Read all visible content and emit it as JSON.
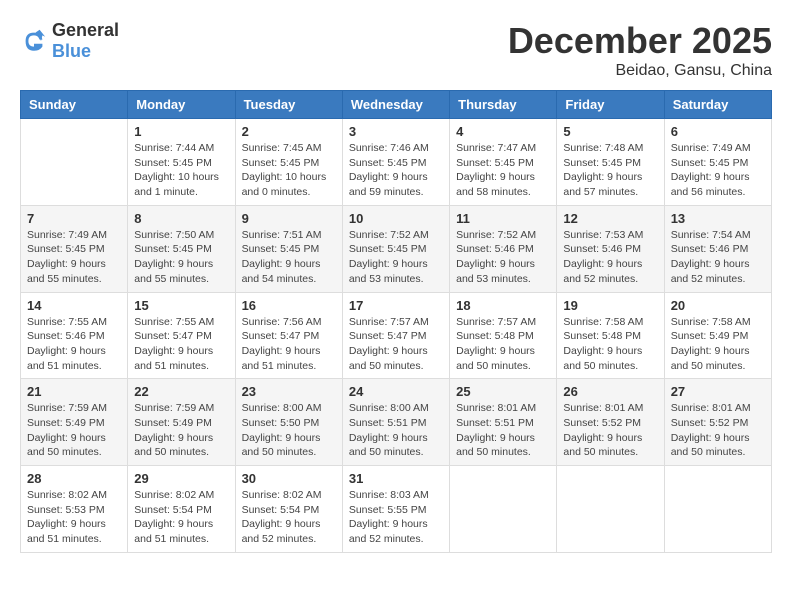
{
  "header": {
    "logo_general": "General",
    "logo_blue": "Blue",
    "month": "December 2025",
    "location": "Beidao, Gansu, China"
  },
  "days_of_week": [
    "Sunday",
    "Monday",
    "Tuesday",
    "Wednesday",
    "Thursday",
    "Friday",
    "Saturday"
  ],
  "weeks": [
    [
      {
        "day": "",
        "empty": true
      },
      {
        "day": "1",
        "sunrise": "Sunrise: 7:44 AM",
        "sunset": "Sunset: 5:45 PM",
        "daylight": "Daylight: 10 hours and 1 minute."
      },
      {
        "day": "2",
        "sunrise": "Sunrise: 7:45 AM",
        "sunset": "Sunset: 5:45 PM",
        "daylight": "Daylight: 10 hours and 0 minutes."
      },
      {
        "day": "3",
        "sunrise": "Sunrise: 7:46 AM",
        "sunset": "Sunset: 5:45 PM",
        "daylight": "Daylight: 9 hours and 59 minutes."
      },
      {
        "day": "4",
        "sunrise": "Sunrise: 7:47 AM",
        "sunset": "Sunset: 5:45 PM",
        "daylight": "Daylight: 9 hours and 58 minutes."
      },
      {
        "day": "5",
        "sunrise": "Sunrise: 7:48 AM",
        "sunset": "Sunset: 5:45 PM",
        "daylight": "Daylight: 9 hours and 57 minutes."
      },
      {
        "day": "6",
        "sunrise": "Sunrise: 7:49 AM",
        "sunset": "Sunset: 5:45 PM",
        "daylight": "Daylight: 9 hours and 56 minutes."
      }
    ],
    [
      {
        "day": "7",
        "sunrise": "Sunrise: 7:49 AM",
        "sunset": "Sunset: 5:45 PM",
        "daylight": "Daylight: 9 hours and 55 minutes."
      },
      {
        "day": "8",
        "sunrise": "Sunrise: 7:50 AM",
        "sunset": "Sunset: 5:45 PM",
        "daylight": "Daylight: 9 hours and 55 minutes."
      },
      {
        "day": "9",
        "sunrise": "Sunrise: 7:51 AM",
        "sunset": "Sunset: 5:45 PM",
        "daylight": "Daylight: 9 hours and 54 minutes."
      },
      {
        "day": "10",
        "sunrise": "Sunrise: 7:52 AM",
        "sunset": "Sunset: 5:45 PM",
        "daylight": "Daylight: 9 hours and 53 minutes."
      },
      {
        "day": "11",
        "sunrise": "Sunrise: 7:52 AM",
        "sunset": "Sunset: 5:46 PM",
        "daylight": "Daylight: 9 hours and 53 minutes."
      },
      {
        "day": "12",
        "sunrise": "Sunrise: 7:53 AM",
        "sunset": "Sunset: 5:46 PM",
        "daylight": "Daylight: 9 hours and 52 minutes."
      },
      {
        "day": "13",
        "sunrise": "Sunrise: 7:54 AM",
        "sunset": "Sunset: 5:46 PM",
        "daylight": "Daylight: 9 hours and 52 minutes."
      }
    ],
    [
      {
        "day": "14",
        "sunrise": "Sunrise: 7:55 AM",
        "sunset": "Sunset: 5:46 PM",
        "daylight": "Daylight: 9 hours and 51 minutes."
      },
      {
        "day": "15",
        "sunrise": "Sunrise: 7:55 AM",
        "sunset": "Sunset: 5:47 PM",
        "daylight": "Daylight: 9 hours and 51 minutes."
      },
      {
        "day": "16",
        "sunrise": "Sunrise: 7:56 AM",
        "sunset": "Sunset: 5:47 PM",
        "daylight": "Daylight: 9 hours and 51 minutes."
      },
      {
        "day": "17",
        "sunrise": "Sunrise: 7:57 AM",
        "sunset": "Sunset: 5:47 PM",
        "daylight": "Daylight: 9 hours and 50 minutes."
      },
      {
        "day": "18",
        "sunrise": "Sunrise: 7:57 AM",
        "sunset": "Sunset: 5:48 PM",
        "daylight": "Daylight: 9 hours and 50 minutes."
      },
      {
        "day": "19",
        "sunrise": "Sunrise: 7:58 AM",
        "sunset": "Sunset: 5:48 PM",
        "daylight": "Daylight: 9 hours and 50 minutes."
      },
      {
        "day": "20",
        "sunrise": "Sunrise: 7:58 AM",
        "sunset": "Sunset: 5:49 PM",
        "daylight": "Daylight: 9 hours and 50 minutes."
      }
    ],
    [
      {
        "day": "21",
        "sunrise": "Sunrise: 7:59 AM",
        "sunset": "Sunset: 5:49 PM",
        "daylight": "Daylight: 9 hours and 50 minutes."
      },
      {
        "day": "22",
        "sunrise": "Sunrise: 7:59 AM",
        "sunset": "Sunset: 5:49 PM",
        "daylight": "Daylight: 9 hours and 50 minutes."
      },
      {
        "day": "23",
        "sunrise": "Sunrise: 8:00 AM",
        "sunset": "Sunset: 5:50 PM",
        "daylight": "Daylight: 9 hours and 50 minutes."
      },
      {
        "day": "24",
        "sunrise": "Sunrise: 8:00 AM",
        "sunset": "Sunset: 5:51 PM",
        "daylight": "Daylight: 9 hours and 50 minutes."
      },
      {
        "day": "25",
        "sunrise": "Sunrise: 8:01 AM",
        "sunset": "Sunset: 5:51 PM",
        "daylight": "Daylight: 9 hours and 50 minutes."
      },
      {
        "day": "26",
        "sunrise": "Sunrise: 8:01 AM",
        "sunset": "Sunset: 5:52 PM",
        "daylight": "Daylight: 9 hours and 50 minutes."
      },
      {
        "day": "27",
        "sunrise": "Sunrise: 8:01 AM",
        "sunset": "Sunset: 5:52 PM",
        "daylight": "Daylight: 9 hours and 50 minutes."
      }
    ],
    [
      {
        "day": "28",
        "sunrise": "Sunrise: 8:02 AM",
        "sunset": "Sunset: 5:53 PM",
        "daylight": "Daylight: 9 hours and 51 minutes."
      },
      {
        "day": "29",
        "sunrise": "Sunrise: 8:02 AM",
        "sunset": "Sunset: 5:54 PM",
        "daylight": "Daylight: 9 hours and 51 minutes."
      },
      {
        "day": "30",
        "sunrise": "Sunrise: 8:02 AM",
        "sunset": "Sunset: 5:54 PM",
        "daylight": "Daylight: 9 hours and 52 minutes."
      },
      {
        "day": "31",
        "sunrise": "Sunrise: 8:03 AM",
        "sunset": "Sunset: 5:55 PM",
        "daylight": "Daylight: 9 hours and 52 minutes."
      },
      {
        "day": "",
        "empty": true
      },
      {
        "day": "",
        "empty": true
      },
      {
        "day": "",
        "empty": true
      }
    ]
  ]
}
